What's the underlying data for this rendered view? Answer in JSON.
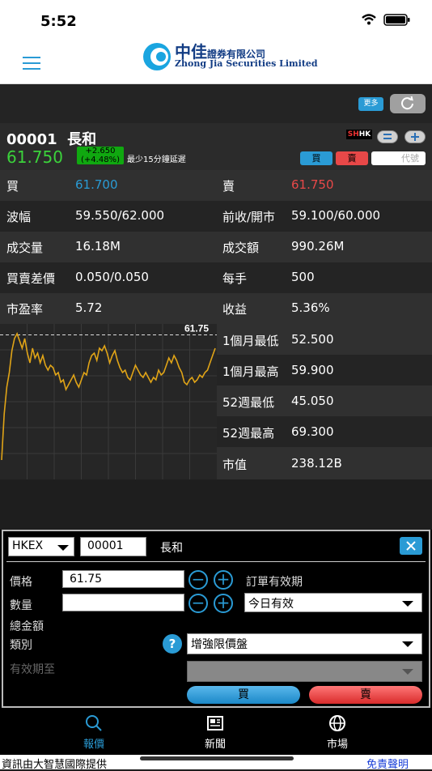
{
  "status": {
    "time": "5:52"
  },
  "brand": {
    "cn": "中佳",
    "cn_small": "證券有限公司",
    "en": "Zhong Jia Securities Limited"
  },
  "toolbar": {
    "more_label": "更多",
    "refresh_icon": "refresh-icon"
  },
  "stock": {
    "code": "00001",
    "name": "長和",
    "price": "61.750",
    "change": "+2.650",
    "change_pct": "(+4.48%)",
    "delay_note": "最少15分鐘延遲",
    "market_badge": {
      "sh": "SH",
      "hk": "HK"
    }
  },
  "actions": {
    "buy": "買",
    "sell": "賣",
    "code_placeholder": "代號"
  },
  "quote": {
    "bid_label": "買",
    "bid": "61.700",
    "ask_label": "賣",
    "ask": "61.750",
    "range_label": "波幅",
    "range": "59.550/62.000",
    "prev_open_label": "前收/開市",
    "prev_open": "59.100/60.000",
    "volume_label": "成交量",
    "volume": "16.18M",
    "turnover_label": "成交額",
    "turnover": "990.26M",
    "spread_label": "買賣差價",
    "spread": "0.050/0.050",
    "lot_label": "每手",
    "lot": "500",
    "pe_label": "市盈率",
    "pe": "5.72",
    "yield_label": "收益",
    "yield": "5.36%",
    "m1_low_label": "1個月最低",
    "m1_low": "52.500",
    "m1_high_label": "1個月最高",
    "m1_high": "59.900",
    "w52_low_label": "52週最低",
    "w52_low": "45.050",
    "w52_high_label": "52週最高",
    "w52_high": "69.300",
    "mcap_label": "市值",
    "mcap": "238.12B"
  },
  "chart_data": {
    "type": "line",
    "ref_label": "61.75",
    "values": [
      56.6,
      58.5,
      59.6,
      60.2,
      61.1,
      61.6,
      61.8,
      61.5,
      61.2,
      61.6,
      61.0,
      60.6,
      61.2,
      60.8,
      61.0,
      60.6,
      60.9,
      60.5,
      60.3,
      60.5,
      60.4,
      60.1,
      60.2,
      59.8,
      59.9,
      59.5,
      59.7,
      59.9,
      60.1,
      59.8,
      59.6,
      59.9,
      60.2,
      60.1,
      60.6,
      60.9,
      61.0,
      60.7,
      61.2,
      61.1,
      61.3,
      61.0,
      60.6,
      60.9,
      61.1,
      60.7,
      60.4,
      60.2,
      60.3,
      60.0,
      59.9,
      60.2,
      60.5,
      60.3,
      60.1,
      60.0,
      60.2,
      60.0,
      59.8,
      60.0,
      59.9,
      60.3,
      60.1,
      60.2,
      60.5,
      60.8,
      60.6,
      60.9,
      60.7,
      60.4,
      60.2,
      59.8,
      59.7,
      59.9,
      60.0,
      59.8,
      59.9,
      60.1,
      60.0,
      60.2,
      60.3,
      60.6,
      60.9,
      61.2
    ],
    "ylim": [
      55.8,
      62.2
    ],
    "ref_value": 61.75,
    "color": "#e0a417"
  },
  "order": {
    "exchange": "HKEX",
    "code": "00001",
    "name": "長和",
    "price_label": "價格",
    "price": "61.75",
    "qty_label": "數量",
    "qty": "",
    "total_label": "總金額",
    "validity_label": "訂單有效期",
    "validity": "今日有效",
    "type_label": "類別",
    "type": "增強限價盤",
    "expiry_label": "有效期至",
    "buy": "買",
    "sell": "賣"
  },
  "tabs": [
    {
      "label": "報價",
      "icon": "search-icon"
    },
    {
      "label": "新聞",
      "icon": "newspaper-icon"
    },
    {
      "label": "市場",
      "icon": "globe-icon"
    }
  ],
  "footer": {
    "provider": "資訊由大智慧國際提供",
    "disclaimer": "免責聲明"
  },
  "colors": {
    "accent": "#2a9bd5",
    "up": "#3bd23b",
    "sell_red": "#e84848",
    "buy_blue": "#2a9bd5"
  }
}
